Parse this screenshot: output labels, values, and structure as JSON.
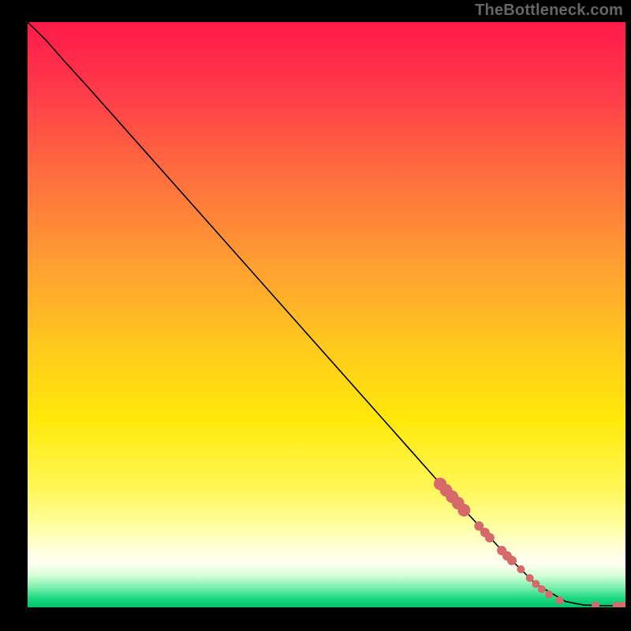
{
  "watermark": "TheBottleneck.com",
  "chart_data": {
    "type": "line",
    "title": "",
    "xlabel": "",
    "ylabel": "",
    "xlim": [
      0,
      100
    ],
    "ylim": [
      0,
      100
    ],
    "curve": [
      {
        "x": 0,
        "y": 100
      },
      {
        "x": 3,
        "y": 97
      },
      {
        "x": 6,
        "y": 93.5
      },
      {
        "x": 10,
        "y": 89
      },
      {
        "x": 20,
        "y": 77.5
      },
      {
        "x": 30,
        "y": 66
      },
      {
        "x": 40,
        "y": 54.5
      },
      {
        "x": 50,
        "y": 43
      },
      {
        "x": 60,
        "y": 31.5
      },
      {
        "x": 70,
        "y": 20
      },
      {
        "x": 80,
        "y": 9
      },
      {
        "x": 85,
        "y": 4
      },
      {
        "x": 90,
        "y": 1
      },
      {
        "x": 93,
        "y": 0.4
      },
      {
        "x": 96,
        "y": 0.3
      },
      {
        "x": 100,
        "y": 0.3
      }
    ],
    "markers": [
      {
        "x": 69,
        "y": 21.1,
        "r": 8
      },
      {
        "x": 70,
        "y": 20.0,
        "r": 8
      },
      {
        "x": 71,
        "y": 18.9,
        "r": 8
      },
      {
        "x": 72,
        "y": 17.8,
        "r": 8
      },
      {
        "x": 73,
        "y": 16.6,
        "r": 8
      },
      {
        "x": 75.5,
        "y": 13.9,
        "r": 6
      },
      {
        "x": 76.5,
        "y": 12.8,
        "r": 6
      },
      {
        "x": 77.3,
        "y": 11.9,
        "r": 6
      },
      {
        "x": 79.3,
        "y": 9.7,
        "r": 6
      },
      {
        "x": 80.2,
        "y": 8.8,
        "r": 6
      },
      {
        "x": 81,
        "y": 8.0,
        "r": 6
      },
      {
        "x": 82.5,
        "y": 6.5,
        "r": 5
      },
      {
        "x": 84,
        "y": 5.0,
        "r": 5
      },
      {
        "x": 85,
        "y": 4.0,
        "r": 5
      },
      {
        "x": 86,
        "y": 3.1,
        "r": 5
      },
      {
        "x": 87.2,
        "y": 2.2,
        "r": 5
      },
      {
        "x": 89,
        "y": 1.2,
        "r": 5
      },
      {
        "x": 95,
        "y": 0.35,
        "r": 5
      },
      {
        "x": 98.5,
        "y": 0.3,
        "r": 5
      },
      {
        "x": 99.5,
        "y": 0.3,
        "r": 5
      }
    ],
    "gradient_stops": [
      {
        "offset": 0.0,
        "color": "#ff1a4a"
      },
      {
        "offset": 0.12,
        "color": "#ff3b4a"
      },
      {
        "offset": 0.25,
        "color": "#ff6a3f"
      },
      {
        "offset": 0.4,
        "color": "#ff9a33"
      },
      {
        "offset": 0.55,
        "color": "#ffc81f"
      },
      {
        "offset": 0.68,
        "color": "#ffe90a"
      },
      {
        "offset": 0.8,
        "color": "#fff75a"
      },
      {
        "offset": 0.86,
        "color": "#ffffa0"
      },
      {
        "offset": 0.905,
        "color": "#ffffe0"
      },
      {
        "offset": 0.925,
        "color": "#fefff0"
      },
      {
        "offset": 0.945,
        "color": "#d8ffd8"
      },
      {
        "offset": 0.965,
        "color": "#80f0b0"
      },
      {
        "offset": 0.985,
        "color": "#19d880"
      },
      {
        "offset": 1.0,
        "color": "#00c46b"
      }
    ],
    "marker_color": "#d66a6a",
    "line_color": "#000000"
  }
}
